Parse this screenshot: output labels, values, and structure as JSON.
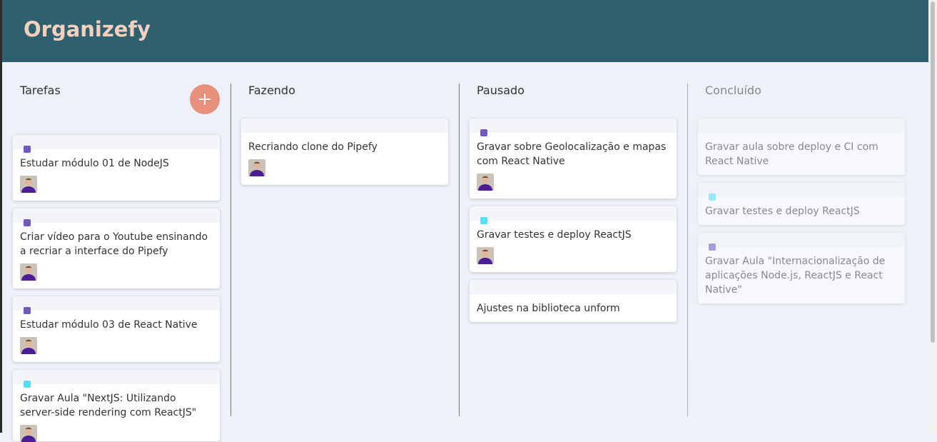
{
  "app": {
    "title": "Organizefy"
  },
  "colors": {
    "header": "#2f6070",
    "brand": "#f6d0bf",
    "add": "#e8907e",
    "purple": "#7159c1",
    "cyan": "#54e1f7"
  },
  "lists": [
    {
      "title": "Tarefas",
      "has_add": true,
      "cards": [
        {
          "text": "Estudar módulo 01 de NodeJS",
          "label": "#7159c1",
          "avatar": true
        },
        {
          "text": "Criar vídeo para o Youtube ensinando a recriar a interface do Pipefy",
          "label": "#7159c1",
          "avatar": true
        },
        {
          "text": "Estudar módulo 03 de React Native",
          "label": "#7159c1",
          "avatar": true
        },
        {
          "text": "Gravar Aula \"NextJS: Utilizando server-side rendering com ReactJS\"",
          "label": "#54e1f7",
          "avatar": true
        }
      ]
    },
    {
      "title": "Fazendo",
      "cards": [
        {
          "text": "Recriando clone do Pipefy",
          "label": null,
          "avatar": true
        }
      ]
    },
    {
      "title": "Pausado",
      "cards": [
        {
          "text": "Gravar sobre Geolocalização e mapas com React Native",
          "label": "#7159c1",
          "avatar": true
        },
        {
          "text": "Gravar testes e deploy ReactJS",
          "label": "#54e1f7",
          "avatar": true
        },
        {
          "text": "Ajustes na biblioteca unform",
          "label": null,
          "avatar": false
        }
      ]
    },
    {
      "title": "Concluído",
      "done": true,
      "cards": [
        {
          "text": "Gravar aula sobre deploy e CI com React Native",
          "label": null,
          "avatar": false
        },
        {
          "text": "Gravar testes e deploy ReactJS",
          "label": "#54e1f7",
          "avatar": false
        },
        {
          "text": "Gravar Aula \"Internacionalização de aplicações Node.js, ReactJS e React Native\"",
          "label": "#7159c1",
          "avatar": false
        }
      ]
    }
  ]
}
